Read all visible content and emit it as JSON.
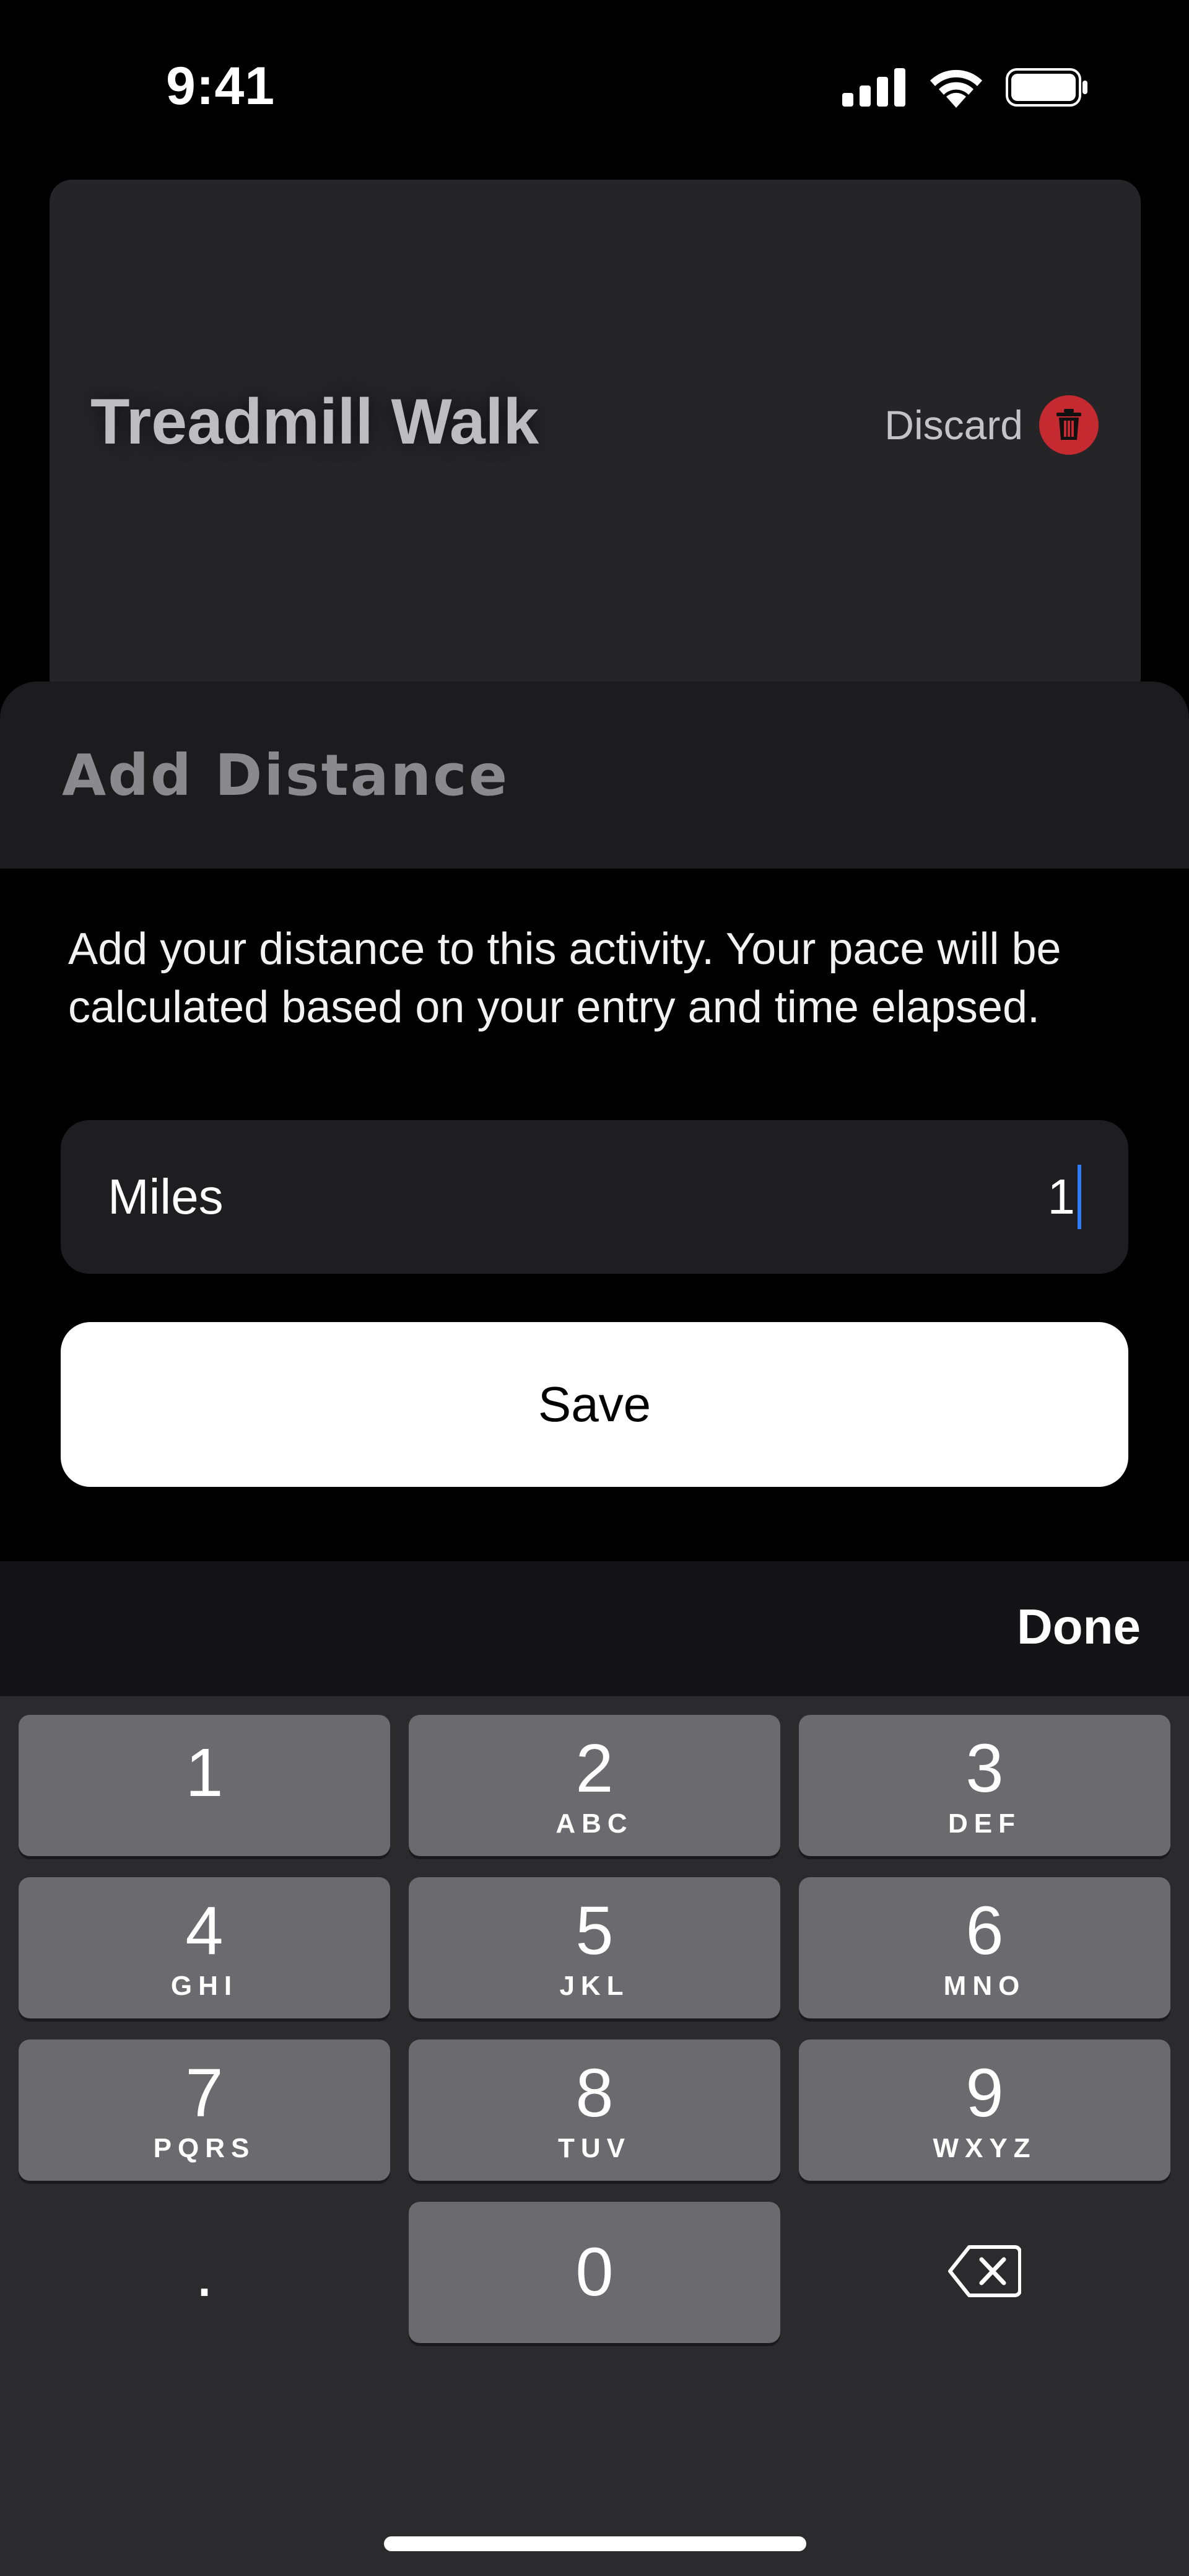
{
  "status_bar": {
    "time": "9:41"
  },
  "card": {
    "title": "Treadmill Walk",
    "discard_label": "Discard"
  },
  "sheet": {
    "title": "Add Distance",
    "description": "Add your distance to this activity. Your pace will be calculated based on your entry and time elapsed.",
    "input": {
      "label": "Miles",
      "value": "1"
    },
    "save_label": "Save"
  },
  "keyboard": {
    "done_label": "Done",
    "keys": [
      {
        "num": "1",
        "letters": ""
      },
      {
        "num": "2",
        "letters": "ABC"
      },
      {
        "num": "3",
        "letters": "DEF"
      },
      {
        "num": "4",
        "letters": "GHI"
      },
      {
        "num": "5",
        "letters": "JKL"
      },
      {
        "num": "6",
        "letters": "MNO"
      },
      {
        "num": "7",
        "letters": "PQRS"
      },
      {
        "num": "8",
        "letters": "TUV"
      },
      {
        "num": "9",
        "letters": "WXYZ"
      },
      {
        "num": ".",
        "letters": ""
      },
      {
        "num": "0",
        "letters": ""
      }
    ]
  },
  "colors": {
    "accent_caret": "#2f7cf6",
    "discard_red": "#c42a2f"
  }
}
